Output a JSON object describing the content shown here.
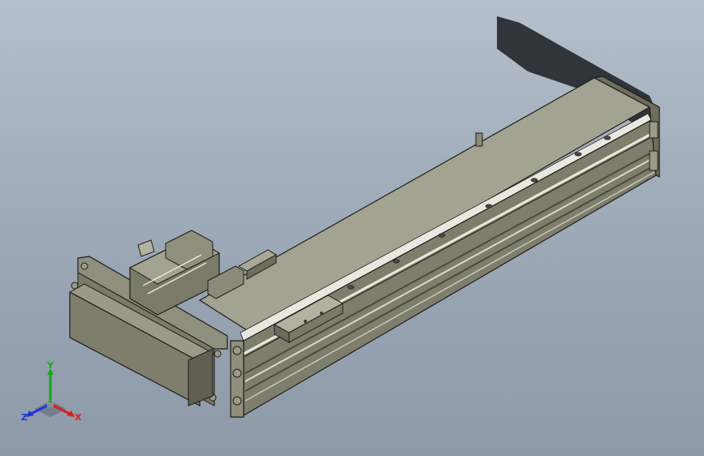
{
  "viewport": {
    "background_top": "#b6c0cc",
    "background_bottom": "#8f9aa9"
  },
  "model": {
    "part_color": "#8b8b79",
    "part_top_color": "#a3a391",
    "part_dark_color": "#5f5f52",
    "edge_color": "#1e1e1a",
    "highlight_color": "#e8e8e0",
    "shadow_color": "#2a2c30"
  },
  "triad": {
    "x_label": "X",
    "y_label": "Y",
    "z_label": "Z",
    "x_color": "#d42020",
    "y_color": "#18a818",
    "z_color": "#1c38d8"
  }
}
